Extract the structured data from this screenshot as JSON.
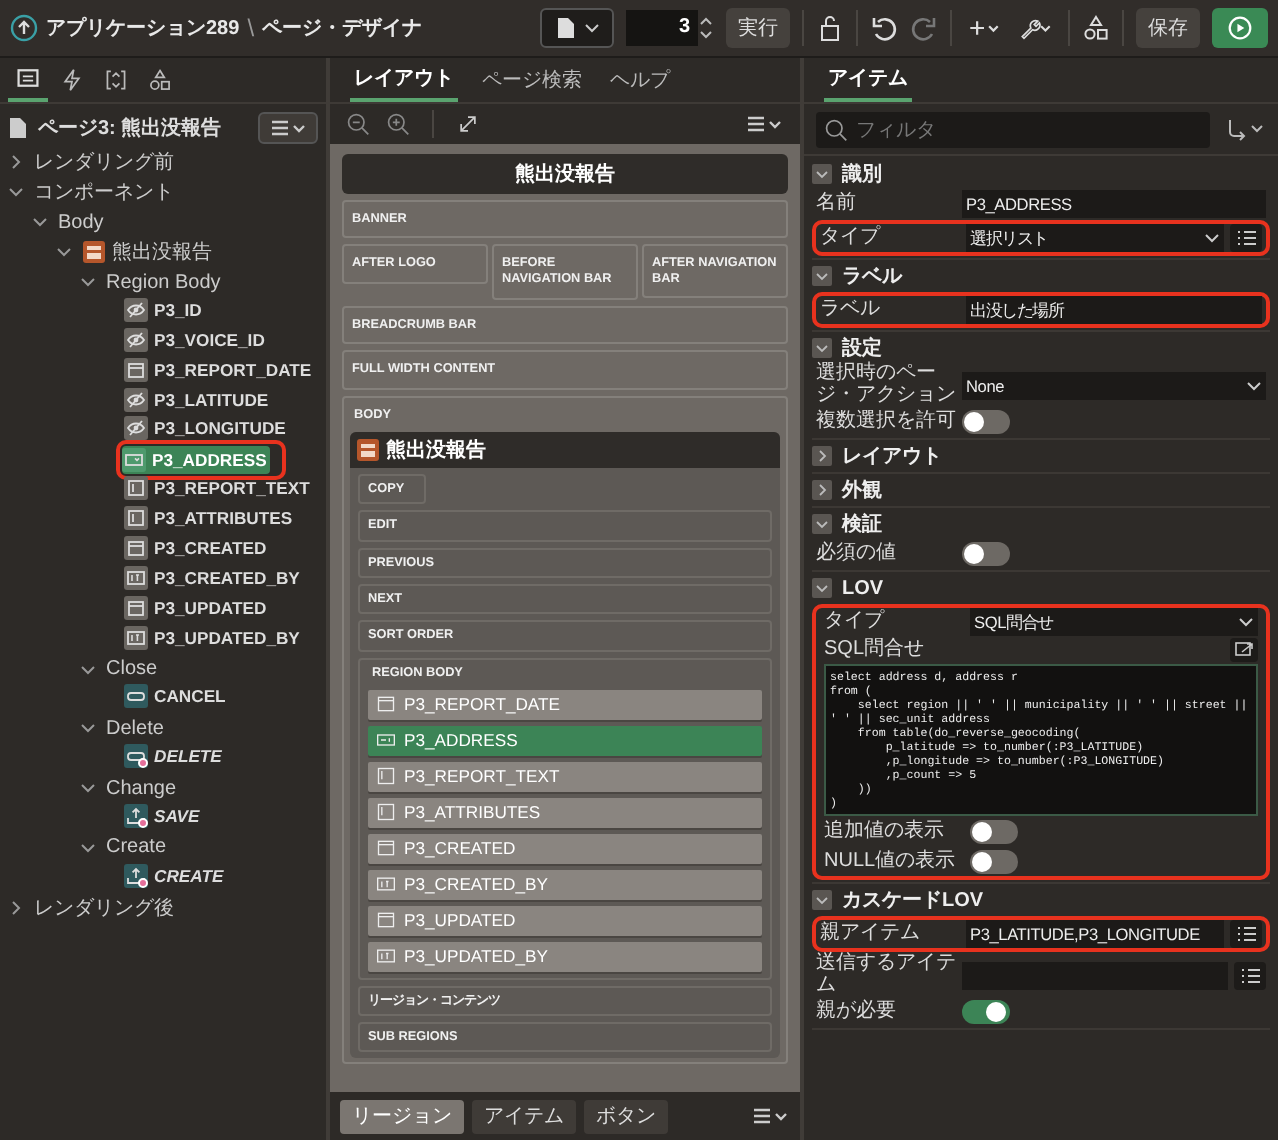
{
  "header": {
    "app": "アプリケーション289",
    "separator": "\\",
    "page": "ページ・デザイナ",
    "page_number": "3",
    "run_label": "実行",
    "save_label": "保存"
  },
  "left": {
    "tabs": [
      {
        "kind": "rendering",
        "selected": true
      },
      {
        "kind": "dynamic-actions",
        "selected": false
      },
      {
        "kind": "processing",
        "selected": false
      },
      {
        "kind": "shared",
        "selected": false
      }
    ],
    "page_label": "ページ3: 熊出没報告",
    "tree": [
      {
        "label": "レンダリング前",
        "kind": "group",
        "expanded": false
      },
      {
        "label": "コンポーネント",
        "kind": "group",
        "expanded": true,
        "children": [
          {
            "label": "Body",
            "kind": "group",
            "expanded": true,
            "children": [
              {
                "label": "熊出没報告",
                "kind": "region",
                "expanded": true,
                "children": [
                  {
                    "label": "Region Body",
                    "kind": "group",
                    "expanded": true,
                    "children": [
                      {
                        "label": "P3_ID",
                        "kind": "hidden",
                        "selected": false
                      },
                      {
                        "label": "P3_VOICE_ID",
                        "kind": "hidden",
                        "selected": false
                      },
                      {
                        "label": "P3_REPORT_DATE",
                        "kind": "date",
                        "selected": false
                      },
                      {
                        "label": "P3_LATITUDE",
                        "kind": "hidden",
                        "selected": false
                      },
                      {
                        "label": "P3_LONGITUDE",
                        "kind": "hidden",
                        "selected": false
                      },
                      {
                        "label": "P3_ADDRESS",
                        "kind": "select",
                        "selected": true,
                        "highlighted": true
                      },
                      {
                        "label": "P3_REPORT_TEXT",
                        "kind": "textarea",
                        "selected": false
                      },
                      {
                        "label": "P3_ATTRIBUTES",
                        "kind": "textarea",
                        "selected": false
                      },
                      {
                        "label": "P3_CREATED",
                        "kind": "date",
                        "selected": false
                      },
                      {
                        "label": "P3_CREATED_BY",
                        "kind": "display",
                        "selected": false
                      },
                      {
                        "label": "P3_UPDATED",
                        "kind": "date",
                        "selected": false
                      },
                      {
                        "label": "P3_UPDATED_BY",
                        "kind": "display",
                        "selected": false
                      }
                    ]
                  },
                  {
                    "label": "Close",
                    "kind": "group",
                    "expanded": true,
                    "children": [
                      {
                        "label": "CANCEL",
                        "kind": "redirect",
                        "selected": false,
                        "conditional": false
                      }
                    ]
                  },
                  {
                    "label": "Delete",
                    "kind": "group",
                    "expanded": true,
                    "children": [
                      {
                        "label": "DELETE",
                        "kind": "redirect",
                        "selected": false,
                        "conditional": true
                      }
                    ]
                  },
                  {
                    "label": "Change",
                    "kind": "group",
                    "expanded": true,
                    "children": [
                      {
                        "label": "SAVE",
                        "kind": "submit",
                        "selected": false,
                        "conditional": true
                      }
                    ]
                  },
                  {
                    "label": "Create",
                    "kind": "group",
                    "expanded": true,
                    "children": [
                      {
                        "label": "CREATE",
                        "kind": "submit",
                        "selected": false,
                        "conditional": true
                      }
                    ]
                  }
                ]
              }
            ]
          }
        ]
      },
      {
        "label": "レンダリング後",
        "kind": "group",
        "expanded": false
      }
    ]
  },
  "middle": {
    "tabs": [
      {
        "label": "レイアウト",
        "selected": true
      },
      {
        "label": "ページ検索",
        "selected": false
      },
      {
        "label": "ヘルプ",
        "selected": false
      }
    ],
    "page_title": "熊出没報告",
    "positions": [
      [
        "BANNER"
      ],
      [
        "AFTER LOGO",
        "BEFORE NAVIGATION BAR",
        "AFTER NAVIGATION BAR"
      ],
      [
        "BREADCRUMB BAR"
      ],
      [
        "FULL WIDTH CONTENT"
      ]
    ],
    "body_label": "BODY",
    "region": {
      "title": "熊出没報告",
      "positions": [
        {
          "label": "COPY",
          "kind": "narrow"
        },
        {
          "label": "EDIT",
          "kind": "full"
        },
        {
          "label": "PREVIOUS",
          "kind": "full"
        },
        {
          "label": "NEXT",
          "kind": "full"
        },
        {
          "label": "SORT ORDER",
          "kind": "full"
        }
      ],
      "body_label": "REGION BODY",
      "items": [
        {
          "label": "P3_REPORT_DATE",
          "kind": "date",
          "selected": false
        },
        {
          "label": "P3_ADDRESS",
          "kind": "select",
          "selected": true
        },
        {
          "label": "P3_REPORT_TEXT",
          "kind": "textarea",
          "selected": false
        },
        {
          "label": "P3_ATTRIBUTES",
          "kind": "textarea",
          "selected": false
        },
        {
          "label": "P3_CREATED",
          "kind": "date",
          "selected": false
        },
        {
          "label": "P3_CREATED_BY",
          "kind": "display",
          "selected": false
        },
        {
          "label": "P3_UPDATED",
          "kind": "date",
          "selected": false
        },
        {
          "label": "P3_UPDATED_BY",
          "kind": "display",
          "selected": false
        }
      ],
      "after": [
        "リージョン・コンテンツ",
        "SUB REGIONS"
      ]
    },
    "bottom_tabs": [
      {
        "label": "リージョン",
        "selected": true
      },
      {
        "label": "アイテム",
        "selected": false
      },
      {
        "label": "ボタン",
        "selected": false
      }
    ]
  },
  "right": {
    "tabs": [
      {
        "label": "アイテム",
        "selected": true
      }
    ],
    "filter": {
      "placeholder": "フィルタ"
    },
    "groups": [
      {
        "title": "識別",
        "expanded": true,
        "rows": [
          {
            "label": "名前",
            "kind": "text",
            "value": "P3_ADDRESS"
          },
          {
            "label": "タイプ",
            "kind": "select",
            "value": "選択リスト",
            "list_button": true,
            "highlighted": true
          }
        ]
      },
      {
        "title": "ラベル",
        "expanded": true,
        "rows": [
          {
            "label": "ラベル",
            "kind": "text",
            "value": "出没した場所",
            "highlighted": true
          }
        ]
      },
      {
        "title": "設定",
        "expanded": true,
        "rows": [
          {
            "label": "選択時のページ・アクション",
            "kind": "select",
            "value": "None"
          },
          {
            "label": "複数選択を許可",
            "kind": "toggle",
            "on": false
          }
        ]
      },
      {
        "title": "レイアウト",
        "expanded": false
      },
      {
        "title": "外観",
        "expanded": false
      },
      {
        "title": "検証",
        "expanded": true,
        "rows": [
          {
            "label": "必須の値",
            "kind": "toggle",
            "on": false
          }
        ]
      },
      {
        "title": "LOV",
        "expanded": true,
        "highlighted": true,
        "rows": [
          {
            "label": "タイプ",
            "kind": "select",
            "value": "SQL問合せ"
          },
          {
            "label": "SQL問合せ",
            "kind": "code",
            "lines": [
              "select address d, address r",
              "from (",
              "    select region || ' ' || municipality || ' ' || street ||",
              "' ' || sec_unit address",
              "    from table(do_reverse_geocoding(",
              "        p_latitude => to_number(:P3_LATITUDE)",
              "        ,p_longitude => to_number(:P3_LONGITUDE)",
              "        ,p_count => 5",
              "    ))",
              ")"
            ]
          },
          {
            "label": "追加値の表示",
            "kind": "toggle",
            "on": false
          },
          {
            "label": "NULL値の表示",
            "kind": "toggle",
            "on": false
          }
        ]
      },
      {
        "title": "カスケードLOV",
        "expanded": true,
        "rows": [
          {
            "label": "親アイテム",
            "kind": "text",
            "value": "P3_LATITUDE,P3_LONGITUDE",
            "list_button": true,
            "highlighted": true
          },
          {
            "label": "送信するアイテム",
            "kind": "text",
            "list_button": true
          },
          {
            "label": "親が必要",
            "kind": "toggle",
            "on": true
          }
        ]
      }
    ]
  }
}
